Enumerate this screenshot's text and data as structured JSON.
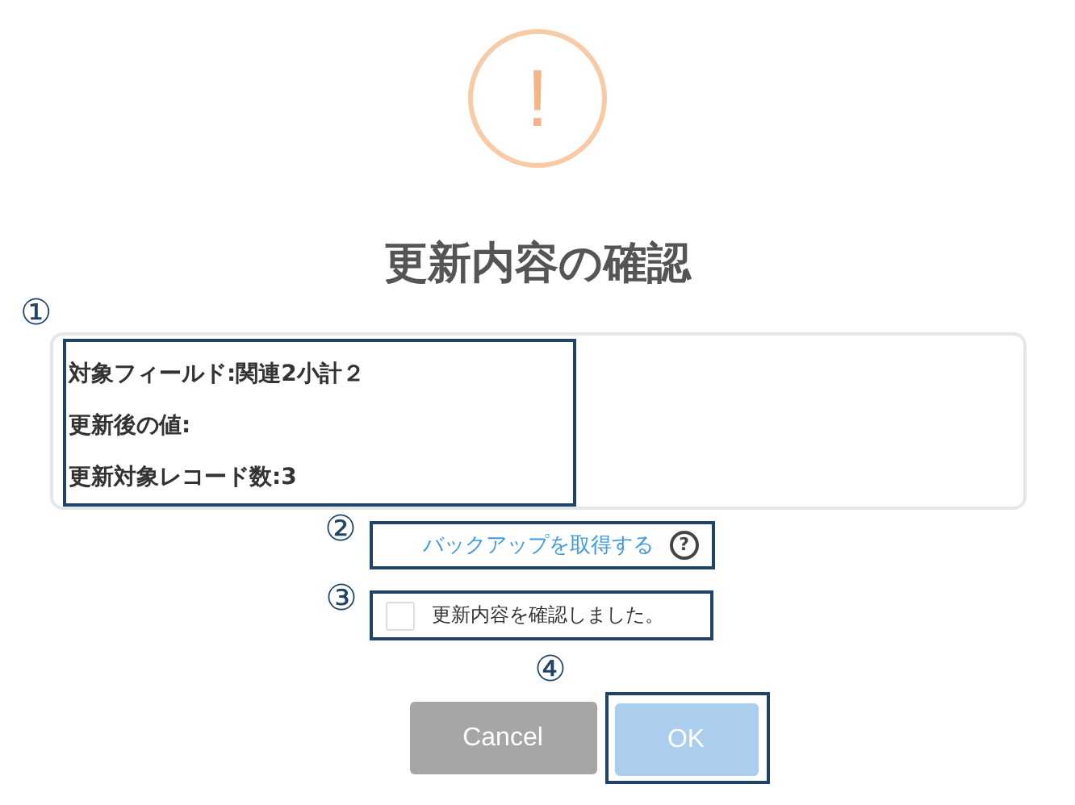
{
  "icon": {
    "glyph": "!"
  },
  "title": "更新内容の確認",
  "summary": {
    "marker": "①",
    "lines": [
      "対象フィールド:関連2小計２",
      "更新後の値:",
      "更新対象レコード数:3"
    ]
  },
  "backup": {
    "marker": "②",
    "link": "バックアップを取得する",
    "help": "?"
  },
  "confirm": {
    "marker": "③",
    "label": "更新内容を確認しました。",
    "checked": false
  },
  "buttons": {
    "marker": "④",
    "cancel": "Cancel",
    "ok": {
      "label": "OK",
      "disabled": true
    }
  }
}
